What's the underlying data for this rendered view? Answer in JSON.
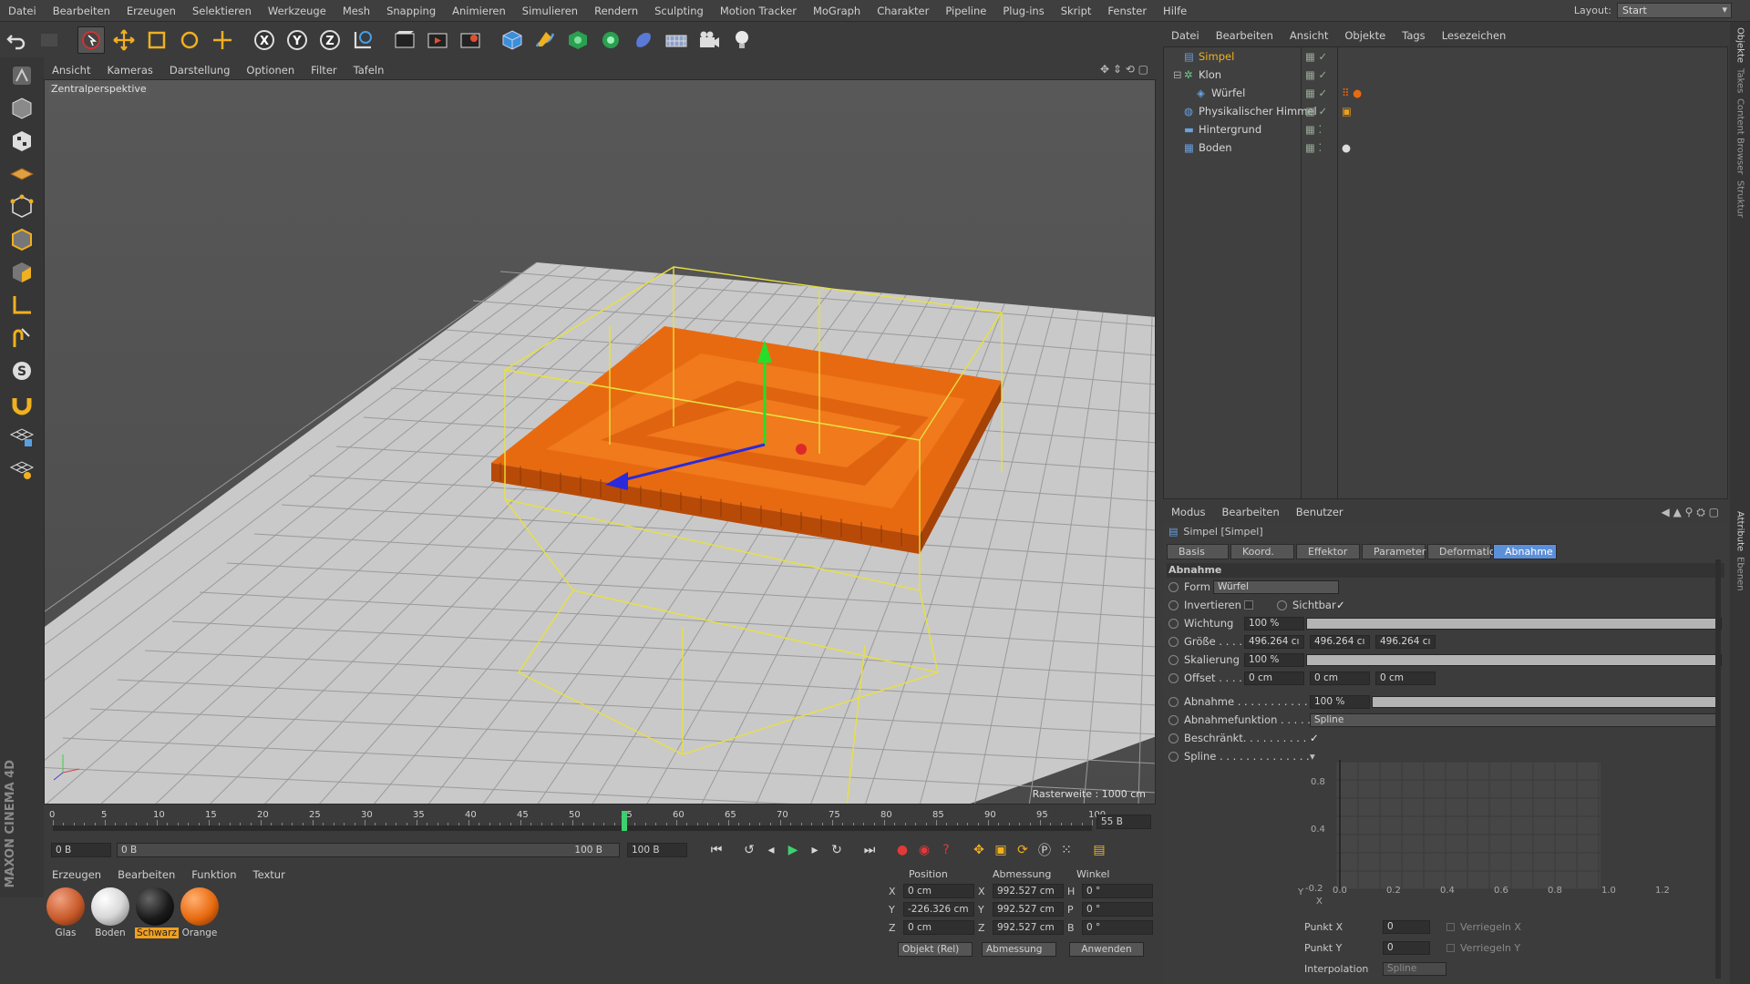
{
  "menubar": {
    "items": [
      "Datei",
      "Bearbeiten",
      "Erzeugen",
      "Selektieren",
      "Werkzeuge",
      "Mesh",
      "Snapping",
      "Animieren",
      "Simulieren",
      "Rendern",
      "Sculpting",
      "Motion Tracker",
      "MoGraph",
      "Charakter",
      "Pipeline",
      "Plug-ins",
      "Skript",
      "Fenster",
      "Hilfe"
    ],
    "layout_label": "Layout:",
    "layout_value": "Start"
  },
  "toolbar": {
    "icons": [
      "undo-icon",
      "redo-icon",
      "select-icon",
      "move-icon",
      "scale-icon",
      "rotate-icon",
      "transform-icon",
      "x-axis-icon",
      "y-axis-icon",
      "z-axis-icon",
      "world-coord-icon",
      "render-view-icon",
      "render-picture-viewer-icon",
      "render-settings-icon",
      "cube-icon",
      "pen-icon",
      "cloner-icon",
      "effector-icon",
      "deformer-icon",
      "floor-icon",
      "camera-icon",
      "light-icon"
    ]
  },
  "viewport": {
    "menu": [
      "Ansicht",
      "Kameras",
      "Darstellung",
      "Optionen",
      "Filter",
      "Tafeln"
    ],
    "camera_label": "Zentralperspektive",
    "grid_label": "Rasterweite : 1000 cm"
  },
  "timeline": {
    "ticks": [
      "0",
      "5",
      "10",
      "15",
      "20",
      "25",
      "30",
      "35",
      "40",
      "45",
      "50",
      "55",
      "60",
      "65",
      "70",
      "75",
      "80",
      "85",
      "90",
      "95",
      "100"
    ],
    "current_frame": 55,
    "end_frame_field": "55 B",
    "start_field": "0 B",
    "range_start": "0 B",
    "range_end": "100 B",
    "end_field": "100 B"
  },
  "materials": {
    "menu": [
      "Erzeugen",
      "Bearbeiten",
      "Funktion",
      "Textur"
    ],
    "items": [
      {
        "name": "Glas",
        "color": "#c85a2a"
      },
      {
        "name": "Boden",
        "color": "#d8d8d8"
      },
      {
        "name": "Schwarz",
        "color": "#1a1a1a"
      },
      {
        "name": "Orange",
        "color": "#e86a10"
      }
    ]
  },
  "coords": {
    "headers": [
      "Position",
      "Abmessung",
      "Winkel"
    ],
    "rows": [
      {
        "axis": "X",
        "pos": "0 cm",
        "dimaxis": "X",
        "dim": "992.527 cm",
        "angaxis": "H",
        "ang": "0 °"
      },
      {
        "axis": "Y",
        "pos": "-226.326 cm",
        "dimaxis": "Y",
        "dim": "992.527 cm",
        "angaxis": "P",
        "ang": "0 °"
      },
      {
        "axis": "Z",
        "pos": "0 cm",
        "dimaxis": "Z",
        "dim": "992.527 cm",
        "angaxis": "B",
        "ang": "0 °"
      }
    ],
    "mode_select": "Objekt (Rel)",
    "size_select": "Abmessung",
    "apply_label": "Anwenden"
  },
  "objects": {
    "menu": [
      "Datei",
      "Bearbeiten",
      "Ansicht",
      "Objekte",
      "Tags",
      "Lesezeichen"
    ],
    "items": [
      {
        "name": "Simpel",
        "indent": 0,
        "selected": true
      },
      {
        "name": "Klon",
        "indent": 0,
        "selected": false
      },
      {
        "name": "Würfel",
        "indent": 1,
        "selected": false
      },
      {
        "name": "Physikalischer Himmel",
        "indent": 0,
        "selected": false
      },
      {
        "name": "Hintergrund",
        "indent": 0,
        "selected": false
      },
      {
        "name": "Boden",
        "indent": 0,
        "selected": false
      }
    ]
  },
  "attributes": {
    "menu": [
      "Modus",
      "Bearbeiten",
      "Benutzer"
    ],
    "object_title": "Simpel [Simpel]",
    "tabs": [
      "Basis",
      "Koord.",
      "Effektor",
      "Parameter",
      "Deformation",
      "Abnahme"
    ],
    "active_tab": "Abnahme",
    "section": "Abnahme",
    "form_label": "Form",
    "form_value": "Würfel",
    "invert_label": "Invertieren",
    "visible_label": "Sichtbar",
    "weight_label": "Wichtung",
    "weight_value": "100 %",
    "size_label": "Größe . . . .",
    "size_values": [
      "496.264 cı",
      "496.264 cı",
      "496.264 cı"
    ],
    "scale_label": "Skalierung",
    "scale_value": "100 %",
    "offset_label": "Offset . . . .",
    "offset_values": [
      "0 cm",
      "0 cm",
      "0 cm"
    ],
    "falloff_label": "Abnahme . . . . . . . . . . . . .",
    "falloff_value": "100 %",
    "falloff_func_label": "Abnahmefunktion . . . . .",
    "falloff_func_value": "Spline",
    "limited_label": "Beschränkt. . . . . . . . . . . .",
    "spline_label": "Spline . . . . . . . . . . . . . .",
    "graph_y_ticks": [
      "0.8",
      "0.4",
      "-0.2"
    ],
    "graph_x_ticks": [
      "0.0",
      "0.2",
      "0.4",
      "0.6",
      "0.8",
      "1.0",
      "1.2"
    ],
    "graph_axis_y": "Y",
    "graph_axis_x": "X",
    "point_x_label": "Punkt X",
    "point_x_value": "0",
    "point_y_label": "Punkt Y",
    "point_y_value": "0",
    "lock_x_label": "Verriegeln X",
    "lock_y_label": "Verriegeln Y",
    "interp_label": "Interpolation",
    "interp_value": "Spline"
  },
  "side_tabs": [
    "Objekte",
    "Takes",
    "Content Browser",
    "Struktur",
    "Attribute",
    "Ebenen"
  ],
  "brand": "MAXON CINEMA 4D"
}
